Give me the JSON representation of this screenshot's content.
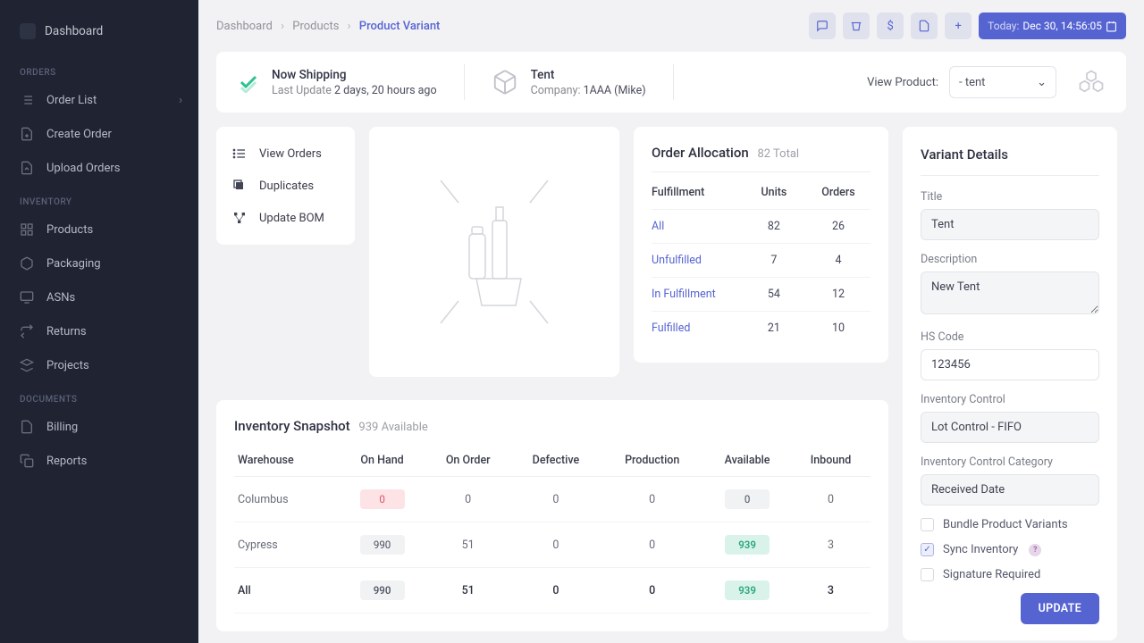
{
  "sidebar": {
    "dashboard": "Dashboard",
    "sections": {
      "orders": "ORDERS",
      "inventory": "INVENTORY",
      "documents": "DOCUMENTS"
    },
    "orders": [
      "Order List",
      "Create Order",
      "Upload Orders"
    ],
    "inventory": [
      "Products",
      "Packaging",
      "ASNs",
      "Returns",
      "Projects"
    ],
    "documents": [
      "Billing",
      "Reports"
    ]
  },
  "breadcrumbs": {
    "a": "Dashboard",
    "b": "Products",
    "c": "Product Variant"
  },
  "today": {
    "label": "Today:",
    "value": "Dec 30, 14:56:05"
  },
  "header": {
    "ship_title": "Now Shipping",
    "ship_sub_pre": "Last Update ",
    "ship_sub_em": "2 days, 20 hours ago",
    "prod_title": "Tent",
    "prod_sub_pre": "Company: ",
    "prod_sub_em": "1AAA (Mike)",
    "view_label": "View Product:",
    "view_value": "- tent"
  },
  "actions": [
    "View Orders",
    "Duplicates",
    "Update BOM"
  ],
  "allocation": {
    "title": "Order Allocation",
    "total": "82 Total",
    "cols": {
      "f": "Fulfillment",
      "u": "Units",
      "o": "Orders"
    },
    "rows": [
      {
        "f": "All",
        "u": "82",
        "o": "26"
      },
      {
        "f": "Unfulfilled",
        "u": "7",
        "o": "4"
      },
      {
        "f": "In Fulfillment",
        "u": "54",
        "o": "12"
      },
      {
        "f": "Fulfilled",
        "u": "21",
        "o": "10"
      }
    ]
  },
  "inventory_snap": {
    "title": "Inventory Snapshot",
    "sub": "939 Available",
    "cols": [
      "Warehouse",
      "On Hand",
      "On Order",
      "Defective",
      "Production",
      "Available",
      "Inbound"
    ],
    "rows": [
      {
        "w": "Columbus",
        "oh": "0",
        "oh_cls": "pill-red",
        "oo": "0",
        "d": "0",
        "p": "0",
        "a": "0",
        "a_cls": "pill-neutral",
        "i": "0"
      },
      {
        "w": "Cypress",
        "oh": "990",
        "oh_cls": "pill-neutral",
        "oo": "51",
        "d": "0",
        "p": "0",
        "a": "939",
        "a_cls": "pill-green",
        "i": "3"
      },
      {
        "w": "All",
        "oh": "990",
        "oh_cls": "pill-neutral",
        "oo": "51",
        "d": "0",
        "p": "0",
        "a": "939",
        "a_cls": "pill-green",
        "i": "3",
        "bold": true
      }
    ]
  },
  "details": {
    "title": "Variant Details",
    "labels": {
      "title": "Title",
      "desc": "Description",
      "hs": "HS Code",
      "ic": "Inventory Control",
      "icc": "Inventory Control Category"
    },
    "values": {
      "title": "Tent",
      "desc": "New Tent",
      "hs": "123456",
      "ic": "Lot Control - FIFO",
      "icc": "Received Date"
    },
    "checks": {
      "bundle": "Bundle Product Variants",
      "sync": "Sync Inventory",
      "sig": "Signature Required"
    },
    "update": "UPDATE"
  }
}
